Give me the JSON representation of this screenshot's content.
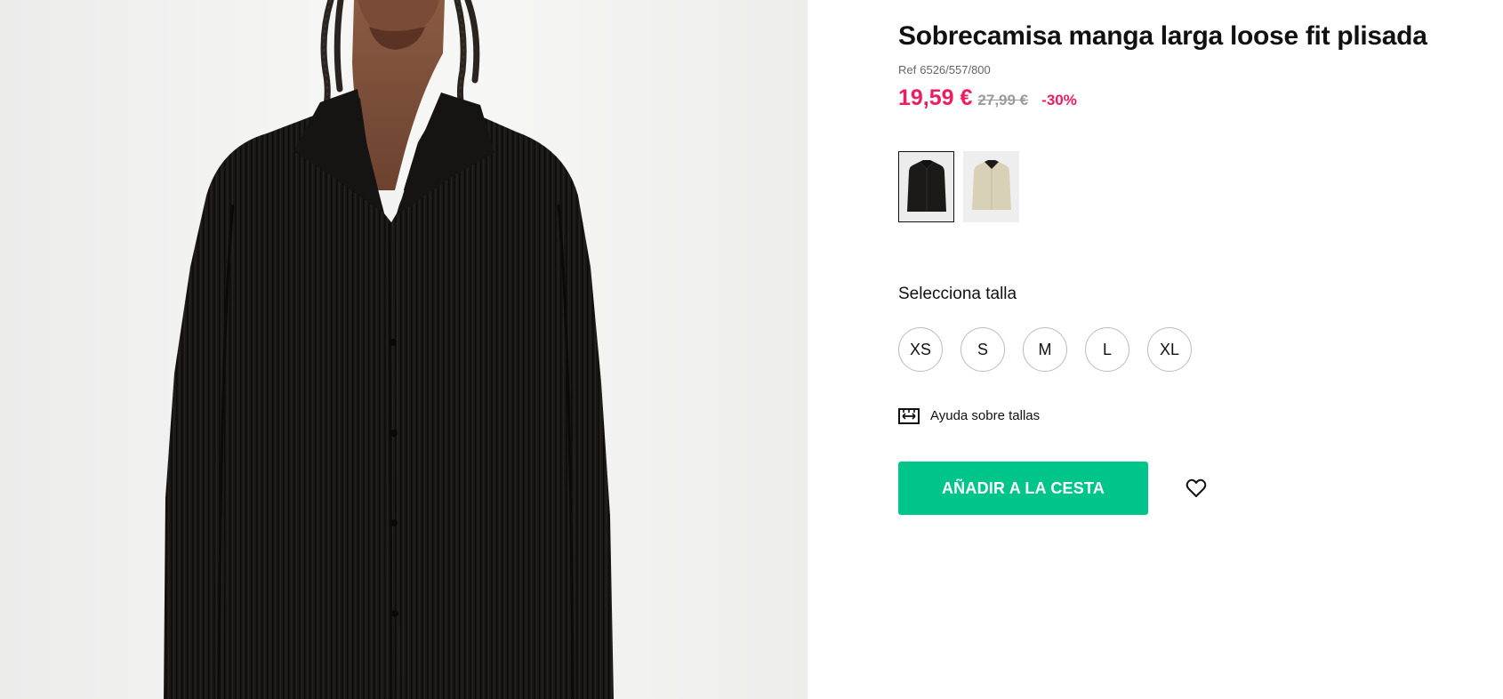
{
  "product": {
    "title": "Sobrecamisa manga larga loose fit plisada",
    "ref_label": "Ref",
    "ref_number": "6526/557/800",
    "price_current": "19,59 €",
    "price_old": "27,99 €",
    "discount": "-30%"
  },
  "colors": {
    "swatches": [
      {
        "name": "black",
        "color": "#1c1a18",
        "selected": true
      },
      {
        "name": "beige",
        "color": "#d9d0b8",
        "selected": false
      }
    ]
  },
  "sizes": {
    "label": "Selecciona talla",
    "options": [
      "XS",
      "S",
      "M",
      "L",
      "XL"
    ]
  },
  "size_help": {
    "label": "Ayuda sobre tallas",
    "icon": "ruler-icon"
  },
  "cta": {
    "add_to_cart": "AÑADIR A LA CESTA",
    "wishlist_icon": "heart-icon"
  },
  "theme": {
    "accent": "#00c58b",
    "sale": "#ee1c60"
  }
}
